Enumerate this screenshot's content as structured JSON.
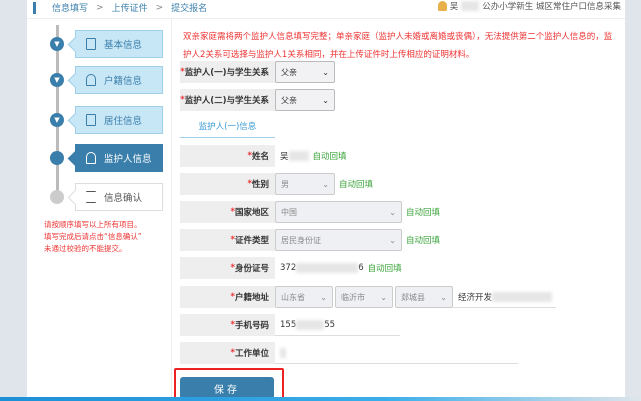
{
  "breadcrumb": [
    "信息填写",
    "上传证件",
    "提交报名"
  ],
  "breadcrumb_sep": ">",
  "user": {
    "prefix": "吴",
    "title": "公办小学新生 城区常住户口信息采集"
  },
  "steps": [
    {
      "label": "基本信息",
      "icon": "document-icon"
    },
    {
      "label": "户籍信息",
      "icon": "user-icon"
    },
    {
      "label": "居住信息",
      "icon": "document-icon"
    },
    {
      "label": "监护人信息",
      "icon": "guardian-icon"
    },
    {
      "label": "信息确认",
      "icon": "hourglass-icon"
    }
  ],
  "side_notes": [
    "请按顺序填写以上所有项目。",
    "填写完成后请点击“信息确认”",
    "未通过校验的不能提交。"
  ],
  "warning": "双亲家庭需将两个监护人信息填写完整；单亲家庭（监护人未婚或离婚或丧偶），无法提供第二个监护人信息的，监护人2关系可选择与监护人1关系相同，并在上传证件时上传相应的证明材料。",
  "relations": [
    {
      "label": "监护人(一)与学生关系",
      "value": "父亲"
    },
    {
      "label": "监护人(二)与学生关系",
      "value": "父亲"
    }
  ],
  "tab": "监护人(一)信息",
  "auto_fill": "自动回填",
  "fields": {
    "name": {
      "label": "姓名",
      "value": "吴"
    },
    "gender": {
      "label": "性别",
      "value": "男"
    },
    "country": {
      "label": "国家地区",
      "value": "中国"
    },
    "id_type": {
      "label": "证件类型",
      "value": "居民身份证"
    },
    "id_no": {
      "label": "身份证号",
      "prefix": "372",
      "suffix": "6"
    },
    "address": {
      "label": "户籍地址",
      "province": "山东省",
      "city": "临沂市",
      "county": "郯城县",
      "detail": "经济开发"
    },
    "phone": {
      "label": "手机号码",
      "prefix": "155",
      "suffix": "55"
    },
    "work": {
      "label": "工作单位",
      "value": ""
    }
  },
  "save_label": "保存",
  "required_mark": "*"
}
